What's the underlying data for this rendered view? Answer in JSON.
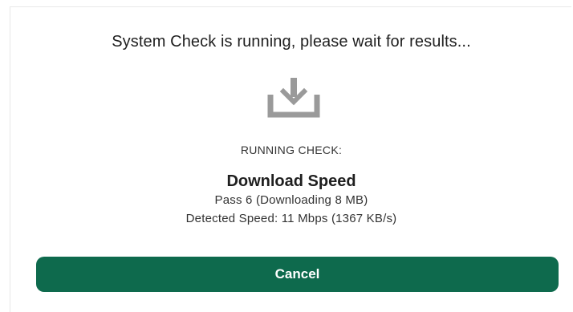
{
  "dialog": {
    "title": "System Check is running, please wait for results...",
    "icon": "download-tray-icon",
    "running_label": "RUNNING CHECK:",
    "check_name": "Download Speed",
    "pass_info": "Pass 6 (Downloading 8 MB)",
    "speed_info": "Detected Speed: 11 Mbps (1367 KB/s)",
    "cancel_label": "Cancel"
  },
  "colors": {
    "accent": "#0e6a4d",
    "icon": "#9a9a9a",
    "text": "#1f1f1f"
  }
}
